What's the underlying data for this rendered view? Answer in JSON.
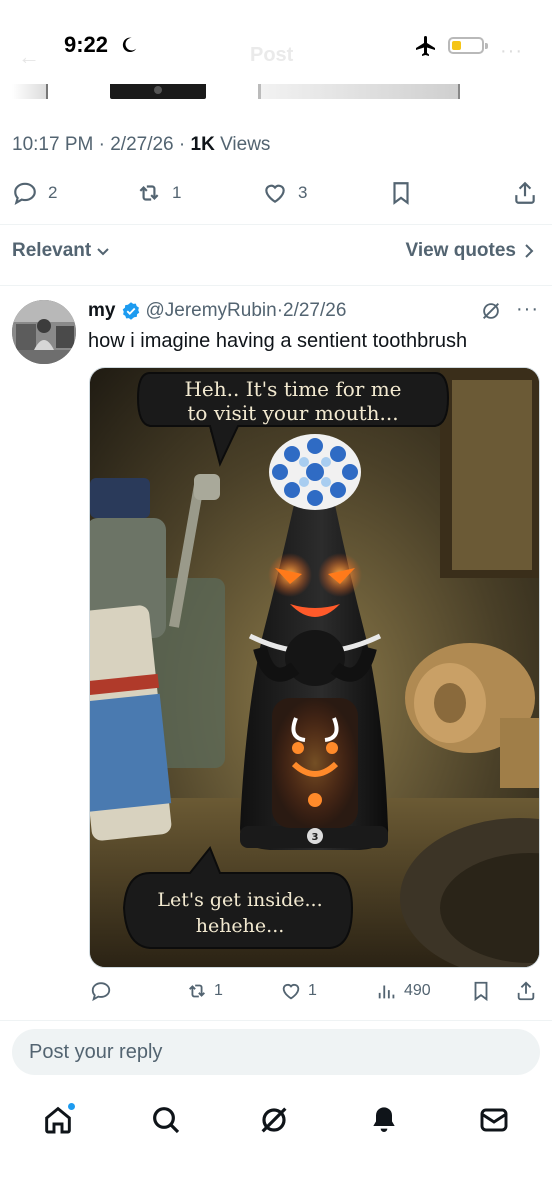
{
  "status_bar": {
    "time": "9:22",
    "header_title": "Post"
  },
  "main_post_meta": {
    "time": "10:17 PM",
    "date": "2/27/26",
    "views_count": "1K",
    "views_label": "Views"
  },
  "main_post_actions": {
    "replies": "2",
    "reposts": "1",
    "likes": "3"
  },
  "sort": {
    "relevant_label": "Relevant",
    "view_quotes_label": "View quotes"
  },
  "reply": {
    "author_name": "my",
    "author_handle": "@JeremyRubin",
    "date": "2/27/26",
    "text": "how i imagine having a sentient toothbrush",
    "image": {
      "bubble_top_line1": "Heh.. It's time for me",
      "bubble_top_line2": "to visit your mouth...",
      "bubble_bottom_line1": "Let's get inside...",
      "bubble_bottom_line2": "hehehe...",
      "mode_label": "3"
    },
    "actions": {
      "replies": "",
      "reposts": "1",
      "likes": "1",
      "views": "490"
    }
  },
  "composer": {
    "placeholder": "Post your reply"
  },
  "colors": {
    "accent": "#1d9bf0",
    "secondary_text": "#536471",
    "primary_text": "#0f1419",
    "battery_low": "#f5c518"
  },
  "icons": {
    "bottom_nav": [
      "home-icon",
      "search-icon",
      "grok-icon",
      "notifications-icon",
      "messages-icon"
    ]
  }
}
